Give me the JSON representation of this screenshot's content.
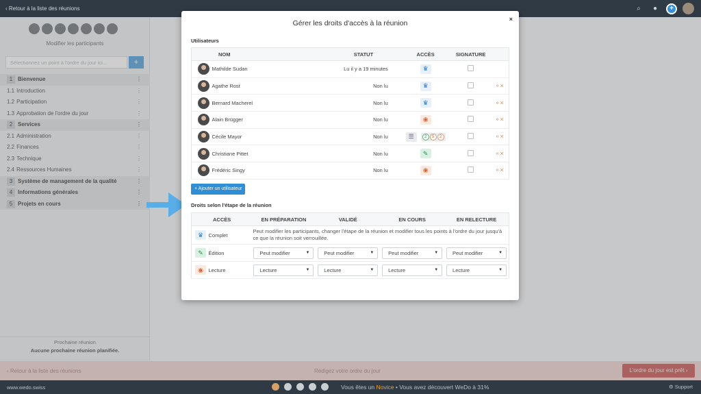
{
  "topbar": {
    "back": "‹ Retour à la liste des réunions"
  },
  "sidebar": {
    "modify_participants": "Modifier les participants",
    "search_placeholder": "Sélectionnez un point à l'ordre du jour ici...",
    "add_label": "+",
    "agenda": [
      {
        "num": "1",
        "label": "Bienvenue",
        "section": true
      },
      {
        "num": "1.1",
        "label": "Introduction",
        "section": false
      },
      {
        "num": "1.2",
        "label": "Participation",
        "section": false
      },
      {
        "num": "1.3",
        "label": "Approbation de l'ordre du jour",
        "section": false
      },
      {
        "num": "2",
        "label": "Services",
        "section": true
      },
      {
        "num": "2.1",
        "label": "Administration",
        "section": false
      },
      {
        "num": "2.2",
        "label": "Finances",
        "section": false
      },
      {
        "num": "2.3",
        "label": "Technique",
        "section": false
      },
      {
        "num": "2.4",
        "label": "Ressources Humaines",
        "section": false
      },
      {
        "num": "3",
        "label": "Système de management de la qualité",
        "section": true
      },
      {
        "num": "4",
        "label": "Informations générales",
        "section": true
      },
      {
        "num": "5",
        "label": "Projets en cours",
        "section": true
      }
    ],
    "next_meeting_label": "Prochaine réunion",
    "next_meeting_value": "Aucune prochaine réunion planifiée."
  },
  "editbar": {
    "back": "‹ Retour à la liste des réunions",
    "prompt": "Rédigez votre ordre du jour",
    "ready_button": "L'ordre du jour est prêt ›"
  },
  "footer": {
    "brand": "www.wedo.swiss",
    "status_prefix": "Vous êtes un ",
    "status_level": "Novice",
    "status_suffix": " • Vous avez découvert WeDo à 31%",
    "progress_percent": 31,
    "support": "Support"
  },
  "modal": {
    "title": "Gérer les droits d'accès à la réunion",
    "close": "×",
    "users_section": "Utilisateurs",
    "users_headers": {
      "name": "NOM",
      "status": "STATUT",
      "access": "ACCÈS",
      "signature": "SIGNATURE"
    },
    "users": [
      {
        "name": "Mathilde Sudan",
        "status": "Lu il y a 19 minutes",
        "access": "crown",
        "removable": false
      },
      {
        "name": "Agathe Rost",
        "status": "Non lu",
        "access": "crown",
        "removable": true
      },
      {
        "name": "Bernard Macherel",
        "status": "Non lu",
        "access": "crown",
        "removable": true
      },
      {
        "name": "Alain Brügger",
        "status": "Non lu",
        "access": "eye",
        "removable": true
      },
      {
        "name": "Cécile Mayor",
        "status": "Non lu",
        "access": "counts",
        "counts": [
          "2",
          "5",
          "2"
        ],
        "removable": true
      },
      {
        "name": "Christiane Pittet",
        "status": "Non lu",
        "access": "pen",
        "removable": true
      },
      {
        "name": "Frédéric Singy",
        "status": "Non lu",
        "access": "eye",
        "removable": true
      }
    ],
    "add_user": "+ Ajouter un utilisateur",
    "steps_section": "Droits selon l'étape de la réunion",
    "steps_headers": {
      "access": "ACCÈS",
      "prep": "EN PRÉPARATION",
      "valid": "VALIDÉ",
      "ongoing": "EN COURS",
      "review": "EN RELECTURE"
    },
    "steps": {
      "complete_label": "Complet",
      "complete_desc": "Peut modifier les participants, changer l'étape de la réunion et modifier tous les points à l'ordre du jour jusqu'à ce que la réunion soit verrouillée.",
      "edit_label": "Édition",
      "edit_values": [
        "Peut modifier",
        "Peut modifier",
        "Peut modifier",
        "Peut modifier"
      ],
      "read_label": "Lecture",
      "read_values": [
        "Lecture",
        "Lecture",
        "Lecture",
        "Lecture"
      ]
    }
  },
  "colors": {
    "primary": "#2f8ed6",
    "crown": "#2e7bbf",
    "eye": "#d6693c",
    "pen": "#2c8e55",
    "arrow": "#5aaee8",
    "topbar": "#2f3a45"
  }
}
